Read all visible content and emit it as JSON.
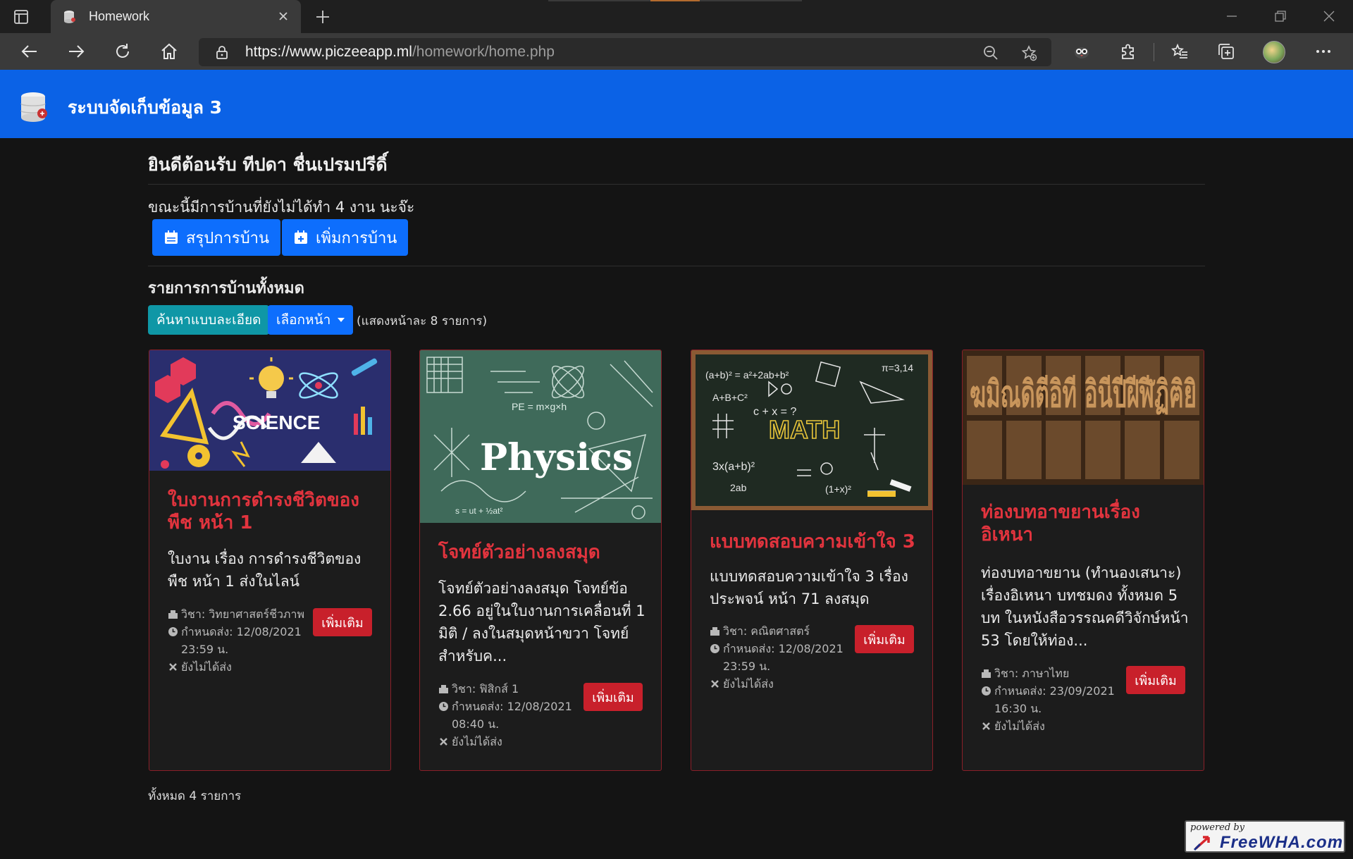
{
  "browser": {
    "tab_title": "Homework",
    "url_prefix": "https://",
    "url_host": "www.piczeeapp.ml",
    "url_path": "/homework/home.php"
  },
  "site": {
    "brand": "ระบบจัดเก็บข้อมูล 3",
    "welcome": "ยินดีต้อนรับ ทีปดา ชื่นเปรมปรีดิ์",
    "pending_text": "ขณะนี้มีการบ้านที่ยังไม่ได้ทำ 4 งาน นะจ๊ะ",
    "summary_button": "สรุปการบ้าน",
    "add_button": "เพิ่มการบ้าน",
    "section_title": "รายการการบ้านทั้งหมด",
    "search_button": "ค้นหาแบบละเอียด",
    "page_select": "เลือกหน้า",
    "per_page_text": "(แสดงหน้าละ 8 รายการ)",
    "total_text": "ทั้งหมด 4 รายการ",
    "powered_by": "powered by",
    "powered_name": "FreeWHA.com"
  },
  "cards": [
    {
      "image_label": "SCIENCE",
      "title": "ใบงานการดำรงชีวิตของพืช หน้า 1",
      "description": "ใบงาน เรื่อง การดำรงชีวิตของพืช หน้า 1 ส่งในไลน์",
      "subject": "วิชา: วิทยาศาสตร์ชีวภาพ",
      "deadline": "กำหนดส่ง: 12/08/2021 23:59 น.",
      "status": "ยังไม่ได้ส่ง",
      "more_button": "เพิ่มเติม"
    },
    {
      "image_label": "Physics",
      "title": "โจทย์ตัวอย่างลงสมุด",
      "description": "โจทย์ตัวอย่างลงสมุด โจทย์ข้อ 2.66 อยู่ในใบงานการเคลื่อนที่ 1 มิติ / ลงในสมุดหน้าขวา โจทย์สำหรับค...",
      "subject": "วิชา: ฟิสิกส์ 1",
      "deadline": "กำหนดส่ง: 12/08/2021 08:40 น.",
      "status": "ยังไม่ได้ส่ง",
      "more_button": "เพิ่มเติม"
    },
    {
      "image_label": "MATH",
      "title": "แบบทดสอบความเข้าใจ 3",
      "description": "แบบทดสอบความเข้าใจ 3 เรื่อง ประพจน์ หน้า 71 ลงสมุด",
      "subject": "วิชา: คณิตศาสตร์",
      "deadline": "กำหนดส่ง: 12/08/2021 23:59 น.",
      "status": "ยังไม่ได้ส่ง",
      "more_button": "เพิ่มเติม"
    },
    {
      "image_label": "ฆมิณดิตีอิที อินีปีฝีฬีฏิฅิยิ",
      "title": "ท่องบทอาขยานเรื่องอิเหนา",
      "description": "ท่องบทอาขยาน (ทำนองเสนาะ) เรื่องอิเหนา บทชมดง ทั้งหมด 5 บท ในหนังสือวรรณคดีวิจักษ์หน้า 53 โดยให้ท่อง...",
      "subject": "วิชา: ภาษาไทย",
      "deadline": "กำหนดส่ง: 23/09/2021 16:30 น.",
      "status": "ยังไม่ได้ส่ง",
      "more_button": "เพิ่มเติม"
    }
  ],
  "colors": {
    "navbar": "#0b62e6",
    "primary": "#0d6efd",
    "info": "#0f97a6",
    "danger": "#c8202b",
    "card_title": "#e2343e",
    "page_bg": "#141414"
  }
}
